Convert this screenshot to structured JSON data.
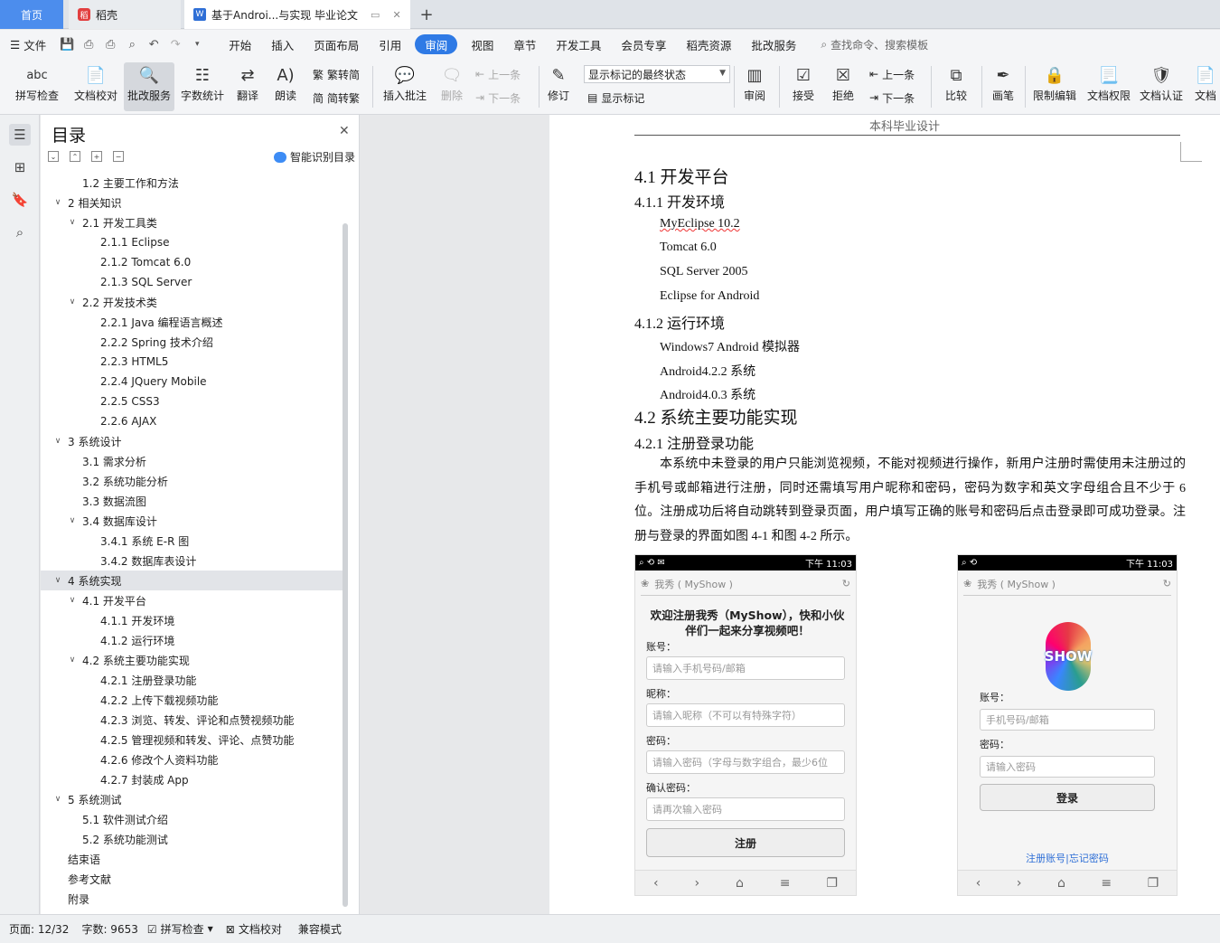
{
  "tabs": {
    "home": "首页",
    "daoke": "稻壳",
    "doc": "基于Androi...与实现 毕业论文",
    "plus": "+"
  },
  "menu": {
    "file": "文件",
    "items": [
      "开始",
      "插入",
      "页面布局",
      "引用",
      "审阅",
      "视图",
      "章节",
      "开发工具",
      "会员专享",
      "稻壳资源",
      "批改服务"
    ],
    "search": "查找命令、搜索模板"
  },
  "ribbon": {
    "spell": "拼写检查",
    "proof": "文档校对",
    "correct": "批改服务",
    "wordcount": "字数统计",
    "translate": "翻译",
    "read": "朗读",
    "t2s": "繁转简",
    "s2t": "简转繁",
    "insert_comment": "插入批注",
    "delete": "删除",
    "prev": "上一条",
    "next": "下一条",
    "revise": "修订",
    "markup_select": "显示标记的最终状态",
    "show_markup": "显示标记",
    "review": "审阅",
    "accept": "接受",
    "reject": "拒绝",
    "prev2": "上一条",
    "next2": "下一条",
    "compare": "比较",
    "pen": "画笔",
    "restrict": "限制编辑",
    "perm": "文档权限",
    "cert": "文档认证",
    "more": "文档"
  },
  "toc": {
    "title": "目录",
    "smart": "智能识别目录",
    "items": [
      {
        "level": 2,
        "chev": "",
        "text": "1.2 主要工作和方法"
      },
      {
        "level": 1,
        "chev": "v",
        "text": "2 相关知识"
      },
      {
        "level": 2,
        "chev": "v",
        "text": "2.1 开发工具类"
      },
      {
        "level": 3,
        "chev": "",
        "text": "2.1.1 Eclipse"
      },
      {
        "level": 3,
        "chev": "",
        "text": "2.1.2 Tomcat 6.0"
      },
      {
        "level": 3,
        "chev": "",
        "text": "2.1.3 SQL Server"
      },
      {
        "level": 2,
        "chev": "v",
        "text": "2.2 开发技术类"
      },
      {
        "level": 3,
        "chev": "",
        "text": "2.2.1 Java 编程语言概述"
      },
      {
        "level": 3,
        "chev": "",
        "text": "2.2.2 Spring 技术介绍"
      },
      {
        "level": 3,
        "chev": "",
        "text": "2.2.3 HTML5"
      },
      {
        "level": 3,
        "chev": "",
        "text": "2.2.4 JQuery Mobile"
      },
      {
        "level": 3,
        "chev": "",
        "text": "2.2.5 CSS3"
      },
      {
        "level": 3,
        "chev": "",
        "text": "2.2.6 AJAX"
      },
      {
        "level": 1,
        "chev": "v",
        "text": "3 系统设计"
      },
      {
        "level": 2,
        "chev": "",
        "text": "3.1 需求分析"
      },
      {
        "level": 2,
        "chev": "",
        "text": "3.2 系统功能分析"
      },
      {
        "level": 2,
        "chev": "",
        "text": "3.3 数据流图"
      },
      {
        "level": 2,
        "chev": "v",
        "text": "3.4 数据库设计"
      },
      {
        "level": 3,
        "chev": "",
        "text": "3.4.1 系统 E-R 图"
      },
      {
        "level": 3,
        "chev": "",
        "text": "3.4.2 数据库表设计"
      },
      {
        "level": 1,
        "chev": "v",
        "text": "4 系统实现",
        "selected": true
      },
      {
        "level": 2,
        "chev": "v",
        "text": "4.1 开发平台"
      },
      {
        "level": 3,
        "chev": "",
        "text": "4.1.1 开发环境"
      },
      {
        "level": 3,
        "chev": "",
        "text": "4.1.2 运行环境"
      },
      {
        "level": 2,
        "chev": "v",
        "text": "4.2 系统主要功能实现"
      },
      {
        "level": 3,
        "chev": "",
        "text": "4.2.1 注册登录功能"
      },
      {
        "level": 3,
        "chev": "",
        "text": "4.2.2 上传下载视频功能"
      },
      {
        "level": 3,
        "chev": "",
        "text": "4.2.3 浏览、转发、评论和点赞视频功能"
      },
      {
        "level": 3,
        "chev": "",
        "text": "4.2.5 管理视频和转发、评论、点赞功能"
      },
      {
        "level": 3,
        "chev": "",
        "text": "4.2.6 修改个人资料功能"
      },
      {
        "level": 3,
        "chev": "",
        "text": "4.2.7 封装成 App"
      },
      {
        "level": 1,
        "chev": "v",
        "text": "5 系统测试"
      },
      {
        "level": 2,
        "chev": "",
        "text": "5.1 软件测试介绍"
      },
      {
        "level": 2,
        "chev": "",
        "text": "5.2 系统功能测试"
      },
      {
        "level": 1,
        "chev": "",
        "text": "结束语"
      },
      {
        "level": 1,
        "chev": "",
        "text": "参考文献"
      },
      {
        "level": 1,
        "chev": "",
        "text": "附录"
      }
    ]
  },
  "doc": {
    "header": "本科毕业设计",
    "h41": "4.1 开发平台",
    "h411": "4.1.1 开发环境",
    "env": [
      "MyEclipse 10.2",
      "Tomcat 6.0",
      "SQL Server 2005",
      "Eclipse for Android"
    ],
    "h412": "4.1.2 运行环境",
    "run": [
      "Windows7 Android 模拟器",
      "Android4.2.2 系统",
      "Android4.0.3 系统"
    ],
    "h42": "4.2 系统主要功能实现",
    "h421": "4.2.1 注册登录功能",
    "para": "本系统中未登录的用户只能浏览视频，不能对视频进行操作，新用户注册时需使用未注册过的手机号或邮箱进行注册，同时还需填写用户昵称和密码，密码为数字和英文字母组合且不少于 6 位。注册成功后将自动跳转到登录页面，用户填写正确的账号和密码后点击登录即可成功登录。注册与登录的界面如图 4-1 和图 4-2 所示。"
  },
  "phone1": {
    "time": "下午 11:03",
    "app": "我秀 ( MyShow )",
    "welcome": "欢迎注册我秀（MyShow），快和小伙伴们一起来分享视频吧！",
    "account_label": "账号：",
    "account_ph": "请输入手机号码/邮箱",
    "nick_label": "昵称：",
    "nick_ph": "请输入昵称（不可以有特殊字符）",
    "pwd_label": "密码：",
    "pwd_ph": "请输入密码（字母与数字组合，最少6位",
    "confirm_label": "确认密码：",
    "confirm_ph": "请再次输入密码",
    "submit": "注册"
  },
  "phone2": {
    "time": "下午 11:03",
    "app": "我秀 ( MyShow )",
    "logo": "SHOW",
    "account_label": "账号：",
    "account_ph": "手机号码/邮箱",
    "pwd_label": "密码：",
    "pwd_ph": "请输入密码",
    "submit": "登录",
    "links": "注册账号|忘记密码"
  },
  "status": {
    "page": "页面: 12/32",
    "words": "字数: 9653",
    "spell": "拼写检查",
    "proof": "文档校对",
    "compat": "兼容模式"
  }
}
